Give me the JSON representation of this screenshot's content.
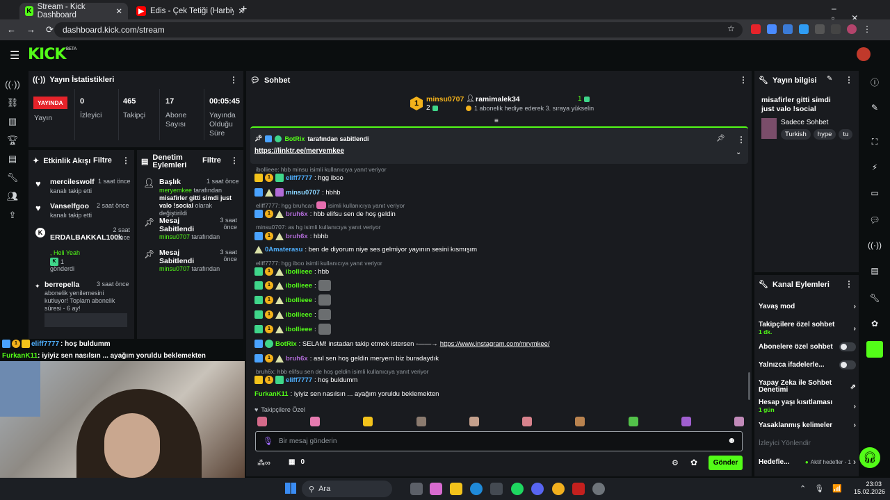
{
  "browser": {
    "tab1": "Stream - Kick Dashboard",
    "tab2": "Edis - Çek Tetiği (Harbiye Live'2",
    "url": "dashboard.kick.com/stream"
  },
  "header": {
    "logo": "KICK",
    "beta": "BETA"
  },
  "stats": {
    "title": "Yayın İstatistikleri",
    "live_badge": "YAYINDA",
    "live_label": "Yayın",
    "viewers_value": "0",
    "viewers_label": "İzleyici",
    "followers_value": "465",
    "followers_label": "Takipçi",
    "subs_value": "17",
    "subs_label": "Abone Sayısı",
    "duration_value": "00:05:45",
    "duration_label": "Yayında Olduğu Süre"
  },
  "activity": {
    "title": "Etkinlik Akışı",
    "filter": "Filtre",
    "items": [
      {
        "name": "mercileswolf",
        "time": "1 saat önce",
        "text": "kanalı takip etti"
      },
      {
        "name": "Vanselfgoo",
        "time": "2 saat önce",
        "text": "kanalı takip etti"
      },
      {
        "name": "ERDALBAKKAL100k",
        "time": "2 saat önce",
        "text1": ", Heli Yeah",
        "text2": "1",
        "text3": "gönderdi"
      },
      {
        "name": "berrepella",
        "time": "3 saat önce",
        "text": "abonelik yenilemesini kutluyor! Toplam abonelik süresi - 6 ay!"
      }
    ]
  },
  "mod": {
    "title": "Denetim Eylemleri",
    "filter": "Filtre",
    "items": [
      {
        "title": "Başlık",
        "time": "1 saat önce",
        "user": "meryemkee",
        "rest1": "tarafından",
        "bold": "misafirler gitti simdi just valo !social",
        "rest2": "olarak değiştirildi"
      },
      {
        "title": "Mesaj Sabitlendi",
        "time": "3 saat önce",
        "user": "minsu0707",
        "rest1": "tarafından"
      },
      {
        "title": "Mesaj Sabitlendi",
        "time": "3 saat önce",
        "user": "minsu0707",
        "rest1": "tarafından"
      }
    ]
  },
  "chat": {
    "title": "Sohbet",
    "top1_name": "minsu0707",
    "top1_count": "2",
    "top2_name": "ramimalek34",
    "top2_count": "1",
    "top2_text": "1 abonelik hediye ederek 3. sıraya yükselin",
    "pinned_by": "BotRix",
    "pinned_by_suffix": "tarafından sabitlendi",
    "pinned_link": "https://linktr.ee/meryemkee",
    "lines": {
      "r1": "ibollieee: hbb minsu isimli kullanıcıya yanıt veriyor",
      "m1u": "eliff7777",
      "m1t": ": hgg iboo",
      "m2u": "minsu0707",
      "m2t": ": hbhb",
      "r3": "eliff7777: hgg bruhcan",
      "r3b": "isimli kullanıcıya yanıt veriyor",
      "m3u": "bruh6x",
      "m3t": ": hbb elifsu sen de hoş geldin",
      "r4": "minsu0707: as hg isimli kullanıcıya yanıt veriyor",
      "m4u": "bruh6x",
      "m4t": ": hbhb",
      "m5u": "0Amaterasu",
      "m5t": ": ben de diyorum niye ses gelmiyor yayının sesini kısmışım",
      "r6": "eliff7777: hgg iboo isimli kullanıcıya yanıt veriyor",
      "m6u": "ibollieee",
      "m6t": ": hbb",
      "m7u": "ibollieee",
      "m8u": "ibollieee",
      "m9u": "ibollieee",
      "m10u": "ibollieee",
      "colon": ":",
      "m11u": "BotRix",
      "m11t": ": SELAM! instadan takip etmek istersen -——→",
      "m11l": "https://www.instagram.com/mrymkee/",
      "m12u": "bruh6x",
      "m12t": ": asıl sen hoş geldin meryem biz buradaydık",
      "r13": "bruh6x: hbb elifsu sen de hoş geldin isimli kullanıcıya yanıt veriyor",
      "m13u": "eliff7777",
      "m13t": ": hoş buldumm",
      "m14u": "FurkanK11",
      "m14t": ": iyiyiz sen nasılsın ... ayağım yoruldu beklemekten"
    },
    "followers_only": "Takipçilere Özel",
    "input_placeholder": "Bir mesaj gönderin",
    "points": "0",
    "send": "Gönder"
  },
  "overlay": {
    "u1": "eliff7777",
    "t1": ": hoş buldumm",
    "u2": "FurkanK11",
    "t2": ": iyiyiz sen nasılsın ... ayağım yoruldu beklemekten"
  },
  "info": {
    "title": "Yayın bilgisi",
    "stream_title": "misafirler gitti simdi just valo !social",
    "category": "Sadece Sohbet",
    "tags": [
      "Turkish",
      "hype",
      "tu"
    ]
  },
  "actions": {
    "title": "Kanal Eylemleri",
    "slow": "Yavaş mod",
    "followers": "Takipçilere özel sohbet",
    "followers_sub": "1 dk.",
    "subs": "Abonelere özel sohbet",
    "emotes": "Yalnızca ifadelerle...",
    "ai": "Yapay Zeka ile Sohbet Denetimi",
    "age": "Hesap yaşı kısıtlaması",
    "age_sub": "1 gün",
    "banned": "Yasaklanmış kelimeler",
    "viewer": "İzleyici Yönlendir",
    "goals": "Hedefle...",
    "goals_sub": "Aktif hedefler - 1"
  },
  "taskbar": {
    "search": "Ara",
    "time": "23:03",
    "date": "15.02.2026"
  }
}
